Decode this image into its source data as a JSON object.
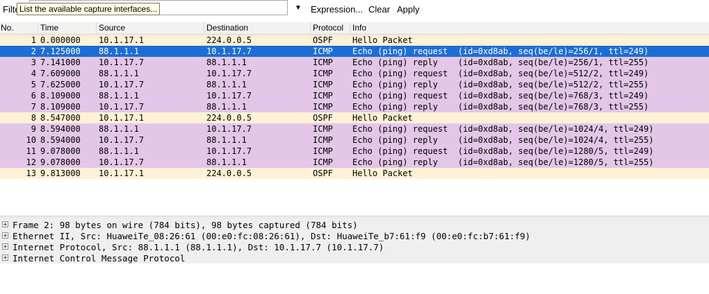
{
  "toolbar": {
    "filter_label": "Filte",
    "filter_value": "",
    "tooltip": "List the available capture interfaces...",
    "expression_label": "Expression...",
    "clear_label": "Clear",
    "apply_label": "Apply"
  },
  "columns": [
    "No.",
    "Time",
    "Source",
    "Destination",
    "Protocol",
    "Info"
  ],
  "packets": [
    {
      "no": "1",
      "time": "0.000000",
      "source": "10.1.17.1",
      "destination": "224.0.0.5",
      "protocol": "OSPF",
      "info": "Hello Packet"
    },
    {
      "no": "2",
      "time": "7.125000",
      "source": "88.1.1.1",
      "destination": "10.1.17.7",
      "protocol": "ICMP",
      "info": "Echo (ping) request  (id=0xd8ab, seq(be/le)=256/1, ttl=249)"
    },
    {
      "no": "3",
      "time": "7.141000",
      "source": "10.1.17.7",
      "destination": "88.1.1.1",
      "protocol": "ICMP",
      "info": "Echo (ping) reply    (id=0xd8ab, seq(be/le)=256/1, ttl=255)"
    },
    {
      "no": "4",
      "time": "7.609000",
      "source": "88.1.1.1",
      "destination": "10.1.17.7",
      "protocol": "ICMP",
      "info": "Echo (ping) request  (id=0xd8ab, seq(be/le)=512/2, ttl=249)"
    },
    {
      "no": "5",
      "time": "7.625000",
      "source": "10.1.17.7",
      "destination": "88.1.1.1",
      "protocol": "ICMP",
      "info": "Echo (ping) reply    (id=0xd8ab, seq(be/le)=512/2, ttl=255)"
    },
    {
      "no": "6",
      "time": "8.109000",
      "source": "88.1.1.1",
      "destination": "10.1.17.7",
      "protocol": "ICMP",
      "info": "Echo (ping) request  (id=0xd8ab, seq(be/le)=768/3, ttl=249)"
    },
    {
      "no": "7",
      "time": "8.109000",
      "source": "10.1.17.7",
      "destination": "88.1.1.1",
      "protocol": "ICMP",
      "info": "Echo (ping) reply    (id=0xd8ab, seq(be/le)=768/3, ttl=255)"
    },
    {
      "no": "8",
      "time": "8.547000",
      "source": "10.1.17.1",
      "destination": "224.0.0.5",
      "protocol": "OSPF",
      "info": "Hello Packet"
    },
    {
      "no": "9",
      "time": "8.594000",
      "source": "88.1.1.1",
      "destination": "10.1.17.7",
      "protocol": "ICMP",
      "info": "Echo (ping) request  (id=0xd8ab, seq(be/le)=1024/4, ttl=249)"
    },
    {
      "no": "10",
      "time": "8.594000",
      "source": "10.1.17.7",
      "destination": "88.1.1.1",
      "protocol": "ICMP",
      "info": "Echo (ping) reply    (id=0xd8ab, seq(be/le)=1024/4, ttl=255)"
    },
    {
      "no": "11",
      "time": "9.078000",
      "source": "88.1.1.1",
      "destination": "10.1.17.7",
      "protocol": "ICMP",
      "info": "Echo (ping) request  (id=0xd8ab, seq(be/le)=1280/5, ttl=249)"
    },
    {
      "no": "12",
      "time": "9.078000",
      "source": "10.1.17.7",
      "destination": "88.1.1.1",
      "protocol": "ICMP",
      "info": "Echo (ping) reply    (id=0xd8ab, seq(be/le)=1280/5, ttl=255)"
    },
    {
      "no": "13",
      "time": "9.813000",
      "source": "10.1.17.1",
      "destination": "224.0.0.5",
      "protocol": "OSPF",
      "info": "Hello Packet"
    }
  ],
  "selected_packet": "2",
  "colors": {
    "ospf": "#fff1d6",
    "icmp": "#e3c6e8",
    "selected": "#1c6ed6"
  },
  "details": [
    {
      "text": "Frame 2: 98 bytes on wire (784 bits), 98 bytes captured (784 bits)"
    },
    {
      "text": "Ethernet II, Src: HuaweiTe_08:26:61 (00:e0:fc:08:26:61), Dst: HuaweiTe_b7:61:f9 (00:e0:fc:b7:61:f9)"
    },
    {
      "text": "Internet Protocol, Src: 88.1.1.1 (88.1.1.1), Dst: 10.1.17.7 (10.1.17.7)"
    },
    {
      "text": "Internet Control Message Protocol"
    }
  ]
}
